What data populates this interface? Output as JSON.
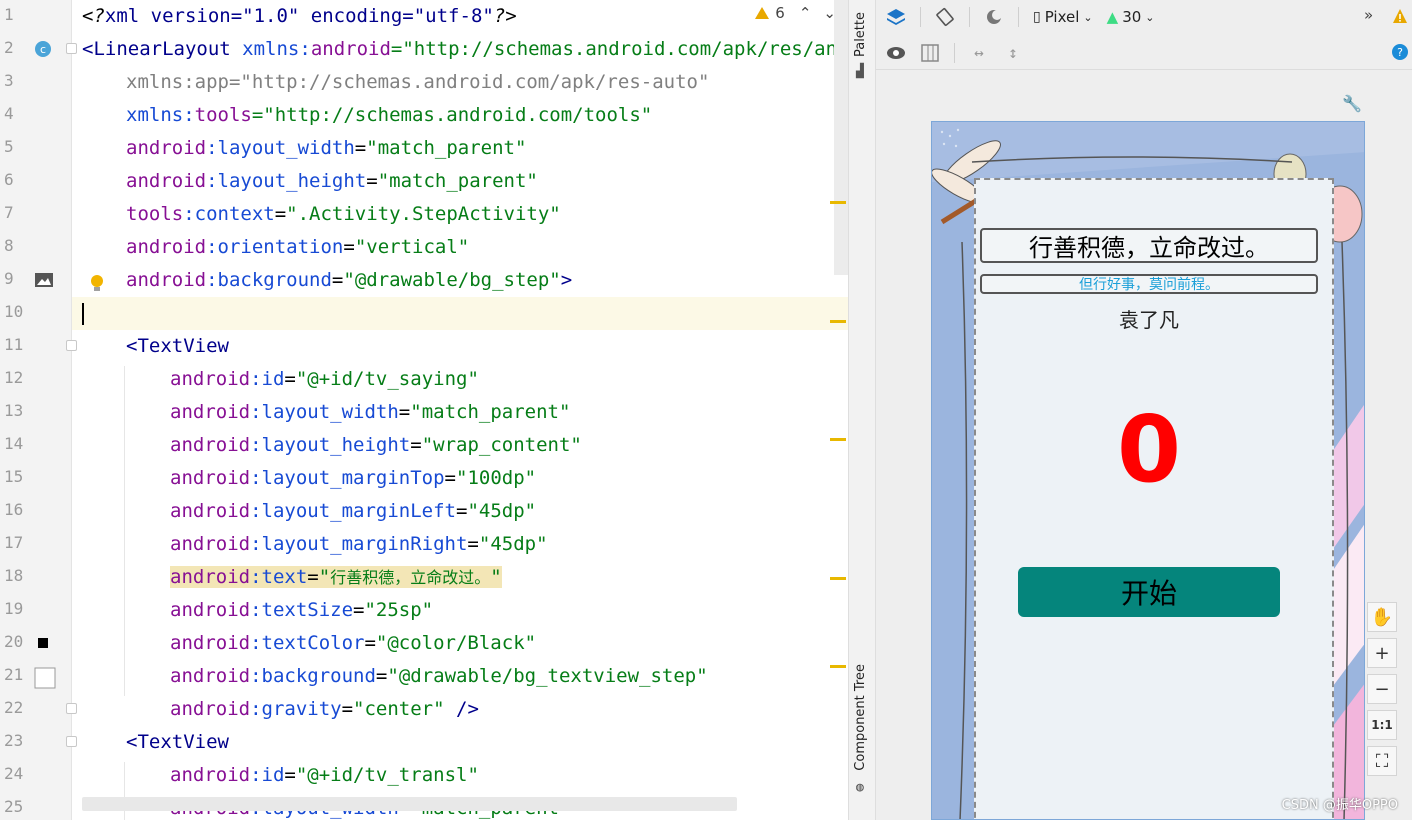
{
  "editor": {
    "inspection": {
      "warning_count": "6",
      "up": "⌃",
      "down": "⌄"
    },
    "lines": [
      {
        "num": "1"
      },
      {
        "num": "2"
      },
      {
        "num": "3"
      },
      {
        "num": "4"
      },
      {
        "num": "5"
      },
      {
        "num": "6"
      },
      {
        "num": "7"
      },
      {
        "num": "8"
      },
      {
        "num": "9"
      },
      {
        "num": "10"
      },
      {
        "num": "11"
      },
      {
        "num": "12"
      },
      {
        "num": "13"
      },
      {
        "num": "14"
      },
      {
        "num": "15"
      },
      {
        "num": "16"
      },
      {
        "num": "17"
      },
      {
        "num": "18"
      },
      {
        "num": "19"
      },
      {
        "num": "20"
      },
      {
        "num": "21"
      },
      {
        "num": "22"
      },
      {
        "num": "23"
      },
      {
        "num": "24"
      },
      {
        "num": "25"
      }
    ],
    "code": {
      "l1": {
        "a": "<?",
        "b": "xml version=\"1.0\" encoding=\"utf-8\"",
        "c": "?>"
      },
      "l2": {
        "a": "<",
        "b": "LinearLayout",
        "c": " xmlns:",
        "d": "android",
        "e": "=\"http://schemas.android.com/apk/res/andro"
      },
      "l3": {
        "a": "xmlns:app=\"http://schemas.android.com/apk/res-auto\""
      },
      "l4": {
        "a": "xmlns:",
        "b": "tools",
        "c": "=\"http://schemas.android.com/tools\""
      },
      "l5": {
        "ns": "android",
        "attr": ":layout_width",
        "eq": "=",
        "val": "\"match_parent\""
      },
      "l6": {
        "ns": "android",
        "attr": ":layout_height",
        "eq": "=",
        "val": "\"match_parent\""
      },
      "l7": {
        "ns": "tools",
        "attr": ":context",
        "eq": "=",
        "val": "\".Activity.StepActivity\""
      },
      "l8": {
        "ns": "android",
        "attr": ":orientation",
        "eq": "=",
        "val": "\"vertical\""
      },
      "l9": {
        "ns": "android",
        "attr": ":background",
        "eq": "=",
        "val": "\"@drawable/bg_step\"",
        "end": ">"
      },
      "l11": {
        "lt": "<",
        "tag": "TextView"
      },
      "l12": {
        "ns": "android",
        "attr": ":id",
        "eq": "=",
        "val": "\"@+id/tv_saying\""
      },
      "l13": {
        "ns": "android",
        "attr": ":layout_width",
        "eq": "=",
        "val": "\"match_parent\""
      },
      "l14": {
        "ns": "android",
        "attr": ":layout_height",
        "eq": "=",
        "val": "\"wrap_content\""
      },
      "l15": {
        "ns": "android",
        "attr": ":layout_marginTop",
        "eq": "=",
        "val": "\"100dp\""
      },
      "l16": {
        "ns": "android",
        "attr": ":layout_marginLeft",
        "eq": "=",
        "val": "\"45dp\""
      },
      "l17": {
        "ns": "android",
        "attr": ":layout_marginRight",
        "eq": "=",
        "val": "\"45dp\""
      },
      "l18": {
        "ns": "android",
        "attr": ":text",
        "eq": "=",
        "q1": "\"",
        "val": "行善积德，立命改过。",
        "q2": "\""
      },
      "l19": {
        "ns": "android",
        "attr": ":textSize",
        "eq": "=",
        "val": "\"25sp\""
      },
      "l20": {
        "ns": "android",
        "attr": ":textColor",
        "eq": "=",
        "val": "\"@color/Black\""
      },
      "l21": {
        "ns": "android",
        "attr": ":background",
        "eq": "=",
        "val": "\"@drawable/bg_textview_step\""
      },
      "l22": {
        "ns": "android",
        "attr": ":gravity",
        "eq": "=",
        "val": "\"center\"",
        "end": " />"
      },
      "l23": {
        "lt": "<",
        "tag": "TextView"
      },
      "l24": {
        "ns": "android",
        "attr": ":id",
        "eq": "=",
        "val": "\"@+id/tv_transl\""
      },
      "l25": {
        "ns": "android",
        "attr": ":layout_width",
        "eq": "=",
        "val": "\"match_parent\""
      }
    }
  },
  "side_tabs": {
    "palette": "Palette",
    "component_tree": "Component Tree"
  },
  "design_toolbar": {
    "device": "Pixel",
    "api_level": "30",
    "more": "»"
  },
  "preview": {
    "saying": "行善积德，立命改过。",
    "translation": "但行好事，莫问前程。",
    "author": "袁了凡",
    "count": "0",
    "start_button": "开始",
    "colors": {
      "count": "#ff0000",
      "button": "#05857c",
      "translation": "#1a9fd8"
    }
  },
  "zoom": {
    "zoom_in": "+",
    "zoom_out": "−",
    "actual_size": "1:1"
  },
  "watermark": "CSDN @振华OPPO"
}
